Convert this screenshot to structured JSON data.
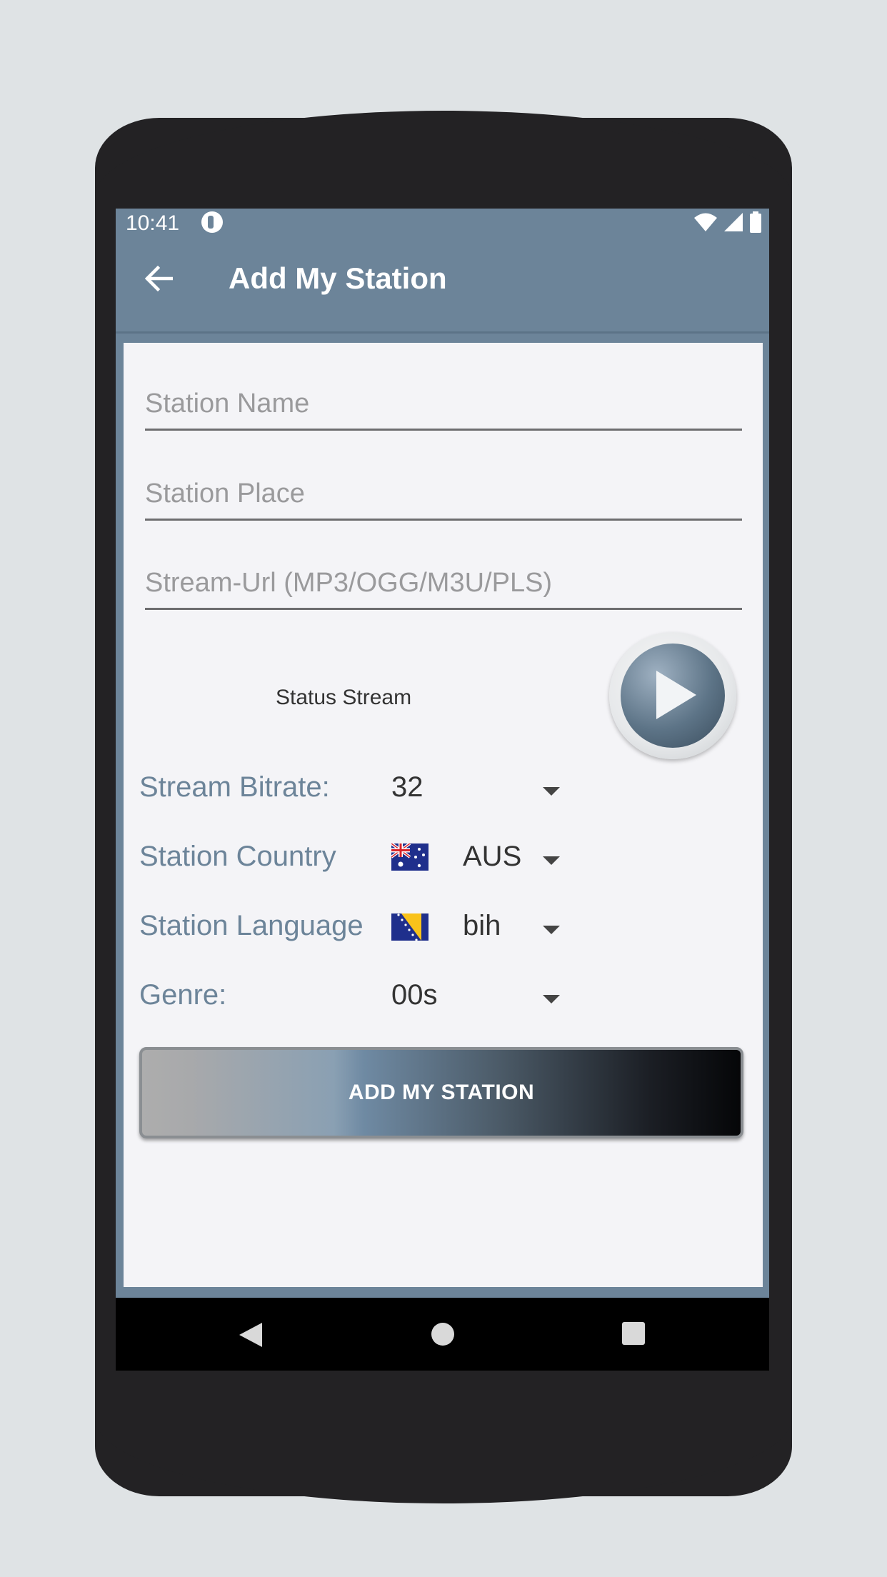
{
  "statusbar": {
    "time": "10:41"
  },
  "appbar": {
    "title": "Add My Station"
  },
  "form": {
    "station_name": {
      "placeholder": "Station Name",
      "value": ""
    },
    "station_place": {
      "placeholder": "Station Place",
      "value": ""
    },
    "stream_url": {
      "placeholder": "Stream-Url (MP3/OGG/M3U/PLS)",
      "value": ""
    },
    "status_stream_label": "Status Stream",
    "bitrate": {
      "label": "Stream Bitrate:",
      "value": "32"
    },
    "country": {
      "label": "Station Country",
      "value": "AUS",
      "flag": "australia-flag"
    },
    "language": {
      "label": "Station Language",
      "value": "bih",
      "flag": "bosnia-flag"
    },
    "genre": {
      "label": "Genre:",
      "value": "00s"
    },
    "submit_label": "ADD MY STATION"
  },
  "colors": {
    "appbar": "#6c8499",
    "label": "#6c8499",
    "content_bg": "#f4f4f7"
  }
}
